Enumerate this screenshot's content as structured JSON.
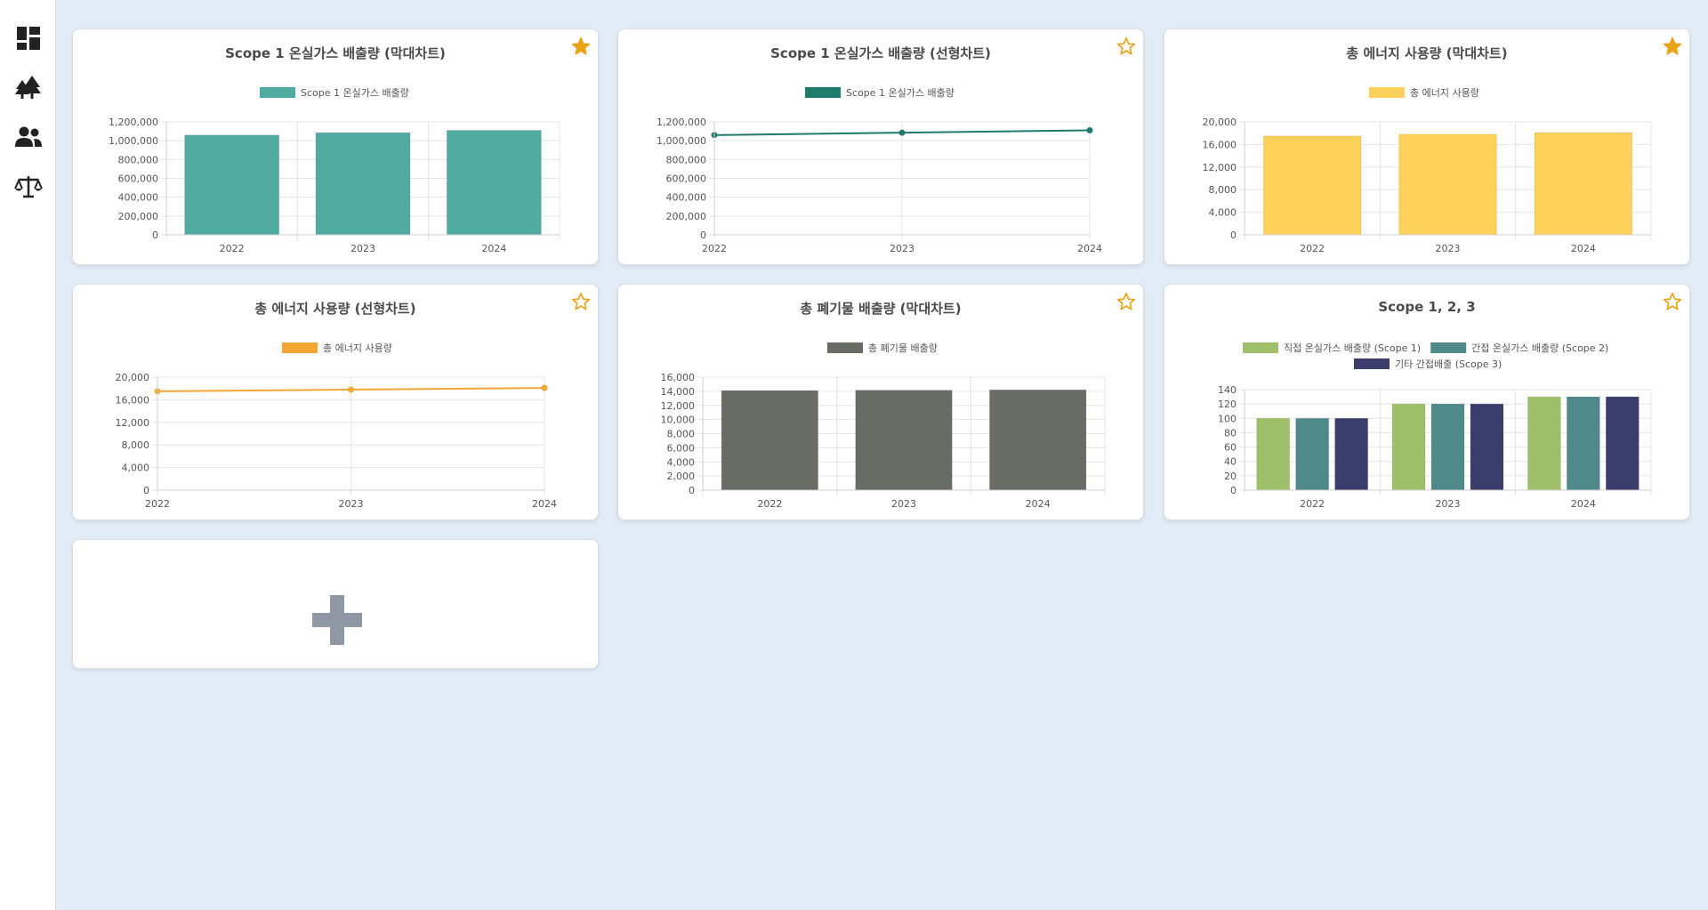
{
  "sidebar": {
    "items": [
      {
        "icon": "dashboard-icon"
      },
      {
        "icon": "trees-icon"
      },
      {
        "icon": "users-icon"
      },
      {
        "icon": "scale-icon"
      }
    ]
  },
  "cards": [
    {
      "title": "Scope 1 온실가스 배출량 (막대차트)",
      "favorite": true,
      "chart": {
        "type": "bar",
        "categories": [
          "2022",
          "2023",
          "2024"
        ],
        "series": [
          {
            "name": "Scope 1 온실가스 배출량",
            "values": [
              1060000,
              1085000,
              1110000
            ],
            "color": "#52aba0"
          }
        ],
        "ylim": [
          0,
          1200000
        ],
        "yticks": [
          "0",
          "200,000",
          "400,000",
          "600,000",
          "800,000",
          "1,000,000",
          "1,200,000"
        ]
      }
    },
    {
      "title": "Scope 1 온실가스 배출량 (선형차트)",
      "favorite": false,
      "chart": {
        "type": "line",
        "categories": [
          "2022",
          "2023",
          "2024"
        ],
        "series": [
          {
            "name": "Scope 1 온실가스 배출량",
            "values": [
              1060000,
              1085000,
              1110000
            ],
            "color": "#1f7a6b"
          }
        ],
        "ylim": [
          0,
          1200000
        ],
        "yticks": [
          "0",
          "200,000",
          "400,000",
          "600,000",
          "800,000",
          "1,000,000",
          "1,200,000"
        ]
      }
    },
    {
      "title": "총 에너지 사용량 (막대차트)",
      "favorite": true,
      "chart": {
        "type": "bar",
        "categories": [
          "2022",
          "2023",
          "2024"
        ],
        "series": [
          {
            "name": "총 에너지 사용량",
            "values": [
              17500,
              17800,
              18100
            ],
            "color": "#fcd15a"
          }
        ],
        "ylim": [
          0,
          20000
        ],
        "yticks": [
          "0",
          "4,000",
          "8,000",
          "12,000",
          "16,000",
          "20,000"
        ]
      }
    },
    {
      "title": "총 에너지 사용량 (선형차트)",
      "favorite": false,
      "chart": {
        "type": "line",
        "categories": [
          "2022",
          "2023",
          "2024"
        ],
        "series": [
          {
            "name": "총 에너지 사용량",
            "values": [
              17500,
              17800,
              18100
            ],
            "color": "#f4a534"
          }
        ],
        "ylim": [
          0,
          20000
        ],
        "yticks": [
          "0",
          "4,000",
          "8,000",
          "12,000",
          "16,000",
          "20,000"
        ]
      }
    },
    {
      "title": "총 폐기물 배출량 (막대차트)",
      "favorite": false,
      "chart": {
        "type": "bar",
        "categories": [
          "2022",
          "2023",
          "2024"
        ],
        "series": [
          {
            "name": "총 폐기물 배출량",
            "values": [
              14100,
              14150,
              14200
            ],
            "color": "#686c64"
          }
        ],
        "ylim": [
          0,
          16000
        ],
        "yticks": [
          "0",
          "2,000",
          "4,000",
          "6,000",
          "8,000",
          "10,000",
          "12,000",
          "14,000",
          "16,000"
        ]
      }
    },
    {
      "title": "Scope 1, 2, 3",
      "favorite": false,
      "chart": {
        "type": "bar",
        "categories": [
          "2022",
          "2023",
          "2024"
        ],
        "series": [
          {
            "name": "직접 온실가스 배출량 (Scope 1)",
            "values": [
              100,
              120,
              130
            ],
            "color": "#a0bf6a"
          },
          {
            "name": "간접 온실가스 배출량 (Scope 2)",
            "values": [
              100,
              120,
              130
            ],
            "color": "#50898a"
          },
          {
            "name": "기타 간접배출 (Scope 3)",
            "values": [
              100,
              120,
              130
            ],
            "color": "#3b3e6a"
          }
        ],
        "ylim": [
          0,
          140
        ],
        "yticks": [
          "0",
          "20",
          "40",
          "60",
          "80",
          "100",
          "120",
          "140"
        ]
      }
    }
  ],
  "chart_data": [
    {
      "type": "bar",
      "title": "Scope 1 온실가스 배출량 (막대차트)",
      "categories": [
        "2022",
        "2023",
        "2024"
      ],
      "series": [
        {
          "name": "Scope 1 온실가스 배출량",
          "values": [
            1060000,
            1085000,
            1110000
          ]
        }
      ],
      "ylim": [
        0,
        1200000
      ]
    },
    {
      "type": "line",
      "title": "Scope 1 온실가스 배출량 (선형차트)",
      "categories": [
        "2022",
        "2023",
        "2024"
      ],
      "series": [
        {
          "name": "Scope 1 온실가스 배출량",
          "values": [
            1060000,
            1085000,
            1110000
          ]
        }
      ],
      "ylim": [
        0,
        1200000
      ]
    },
    {
      "type": "bar",
      "title": "총 에너지 사용량 (막대차트)",
      "categories": [
        "2022",
        "2023",
        "2024"
      ],
      "series": [
        {
          "name": "총 에너지 사용량",
          "values": [
            17500,
            17800,
            18100
          ]
        }
      ],
      "ylim": [
        0,
        20000
      ]
    },
    {
      "type": "line",
      "title": "총 에너지 사용량 (선형차트)",
      "categories": [
        "2022",
        "2023",
        "2024"
      ],
      "series": [
        {
          "name": "총 에너지 사용량",
          "values": [
            17500,
            17800,
            18100
          ]
        }
      ],
      "ylim": [
        0,
        20000
      ]
    },
    {
      "type": "bar",
      "title": "총 폐기물 배출량 (막대차트)",
      "categories": [
        "2022",
        "2023",
        "2024"
      ],
      "series": [
        {
          "name": "총 폐기물 배출량",
          "values": [
            14100,
            14150,
            14200
          ]
        }
      ],
      "ylim": [
        0,
        16000
      ]
    },
    {
      "type": "bar",
      "title": "Scope 1, 2, 3",
      "categories": [
        "2022",
        "2023",
        "2024"
      ],
      "series": [
        {
          "name": "직접 온실가스 배출량 (Scope 1)",
          "values": [
            100,
            120,
            130
          ]
        },
        {
          "name": "간접 온실가스 배출량 (Scope 2)",
          "values": [
            100,
            120,
            130
          ]
        },
        {
          "name": "기타 간접배출 (Scope 3)",
          "values": [
            100,
            120,
            130
          ]
        }
      ],
      "ylim": [
        0,
        140
      ]
    }
  ],
  "add_card": {
    "icon": "plus-icon"
  }
}
